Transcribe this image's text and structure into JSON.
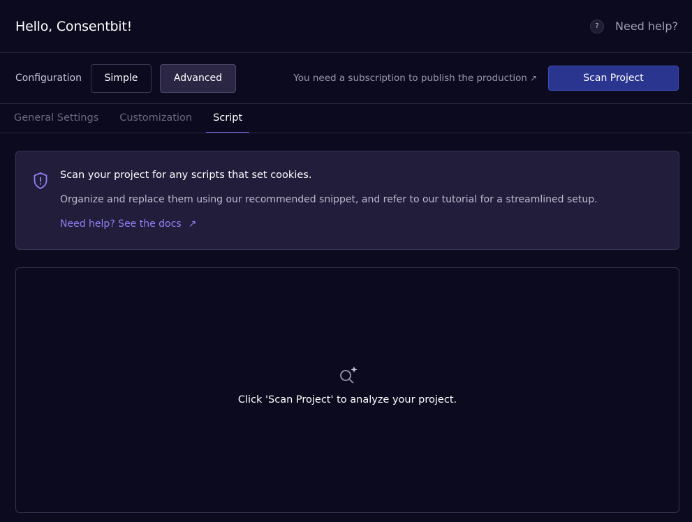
{
  "header": {
    "greeting": "Hello, Consentbit!",
    "help_icon_glyph": "?",
    "help_label": "Need help?"
  },
  "config": {
    "label": "Configuration",
    "modes": [
      "Simple",
      "Advanced"
    ],
    "selected_mode": "Advanced",
    "subscription_note": "You need a subscription to publish the production",
    "subscription_arrow": "↗",
    "scan_button": "Scan Project"
  },
  "tabs": [
    {
      "label": "General Settings",
      "active": false
    },
    {
      "label": "Customization",
      "active": false
    },
    {
      "label": "Script",
      "active": true
    }
  ],
  "info": {
    "icon": "shield-icon",
    "title": "Scan your project for any scripts that set cookies.",
    "description": "Organize and replace them using our recommended snippet, and refer to our tutorial for a streamlined setup.",
    "link_label": "Need help? See the docs",
    "link_arrow": "↗"
  },
  "empty_state": {
    "icon": "search-sparkle-icon",
    "text": "Click 'Scan Project' to analyze your project."
  },
  "colors": {
    "background": "#0c0a1e",
    "accent": "#7c6cf0",
    "primary_button": "#2a3590",
    "link": "#8f82f5",
    "card": "#221d3b"
  }
}
